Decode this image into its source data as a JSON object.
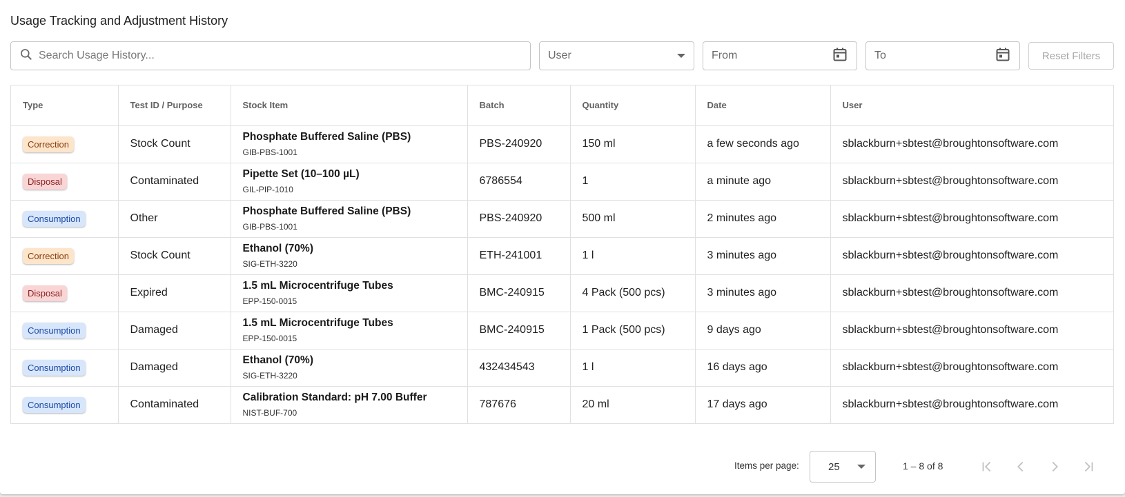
{
  "page": {
    "title": "Usage Tracking and Adjustment History"
  },
  "filters": {
    "search_placeholder": "Search Usage History...",
    "user_label": "User",
    "from_label": "From",
    "to_label": "To",
    "reset_label": "Reset Filters"
  },
  "table": {
    "columns": [
      "Type",
      "Test ID / Purpose",
      "Stock Item",
      "Batch",
      "Quantity",
      "Date",
      "User"
    ],
    "rows": [
      {
        "type": "Correction",
        "purpose": "Stock Count",
        "item_name": "Phosphate Buffered Saline (PBS)",
        "item_code": "GIB-PBS-1001",
        "batch": "PBS-240920",
        "quantity": "150 ml",
        "date": "a few seconds ago",
        "user": "sblackburn+sbtest@broughtonsoftware.com"
      },
      {
        "type": "Disposal",
        "purpose": "Contaminated",
        "item_name": "Pipette Set (10–100 µL)",
        "item_code": "GIL-PIP-1010",
        "batch": "6786554",
        "quantity": "1",
        "date": "a minute ago",
        "user": "sblackburn+sbtest@broughtonsoftware.com"
      },
      {
        "type": "Consumption",
        "purpose": "Other",
        "item_name": "Phosphate Buffered Saline (PBS)",
        "item_code": "GIB-PBS-1001",
        "batch": "PBS-240920",
        "quantity": "500 ml",
        "date": "2 minutes ago",
        "user": "sblackburn+sbtest@broughtonsoftware.com"
      },
      {
        "type": "Correction",
        "purpose": "Stock Count",
        "item_name": "Ethanol (70%)",
        "item_code": "SIG-ETH-3220",
        "batch": "ETH-241001",
        "quantity": "1 l",
        "date": "3 minutes ago",
        "user": "sblackburn+sbtest@broughtonsoftware.com"
      },
      {
        "type": "Disposal",
        "purpose": "Expired",
        "item_name": "1.5 mL Microcentrifuge Tubes",
        "item_code": "EPP-150-0015",
        "batch": "BMC-240915",
        "quantity": "4 Pack (500 pcs)",
        "date": "3 minutes ago",
        "user": "sblackburn+sbtest@broughtonsoftware.com"
      },
      {
        "type": "Consumption",
        "purpose": "Damaged",
        "item_name": "1.5 mL Microcentrifuge Tubes",
        "item_code": "EPP-150-0015",
        "batch": "BMC-240915",
        "quantity": "1 Pack (500 pcs)",
        "date": "9 days ago",
        "user": "sblackburn+sbtest@broughtonsoftware.com"
      },
      {
        "type": "Consumption",
        "purpose": "Damaged",
        "item_name": "Ethanol (70%)",
        "item_code": "SIG-ETH-3220",
        "batch": "432434543",
        "quantity": "1 l",
        "date": "16 days ago",
        "user": "sblackburn+sbtest@broughtonsoftware.com"
      },
      {
        "type": "Consumption",
        "purpose": "Contaminated",
        "item_name": "Calibration Standard: pH 7.00 Buffer",
        "item_code": "NIST-BUF-700",
        "batch": "787676",
        "quantity": "20 ml",
        "date": "17 days ago",
        "user": "sblackburn+sbtest@broughtonsoftware.com"
      }
    ]
  },
  "paginator": {
    "items_per_page_label": "Items per page:",
    "page_size": "25",
    "range_label": "1 – 8 of 8"
  },
  "colors": {
    "correction_bg": "#fde5cc",
    "disposal_bg": "#f9d5d5",
    "consumption_bg": "#d8e6fb"
  },
  "icons": {
    "search": "search-icon",
    "calendar": "calendar-icon",
    "dropdown": "chevron-down-icon",
    "first_page": "first-page-icon",
    "prev_page": "chevron-left-icon",
    "next_page": "chevron-right-icon",
    "last_page": "last-page-icon"
  }
}
